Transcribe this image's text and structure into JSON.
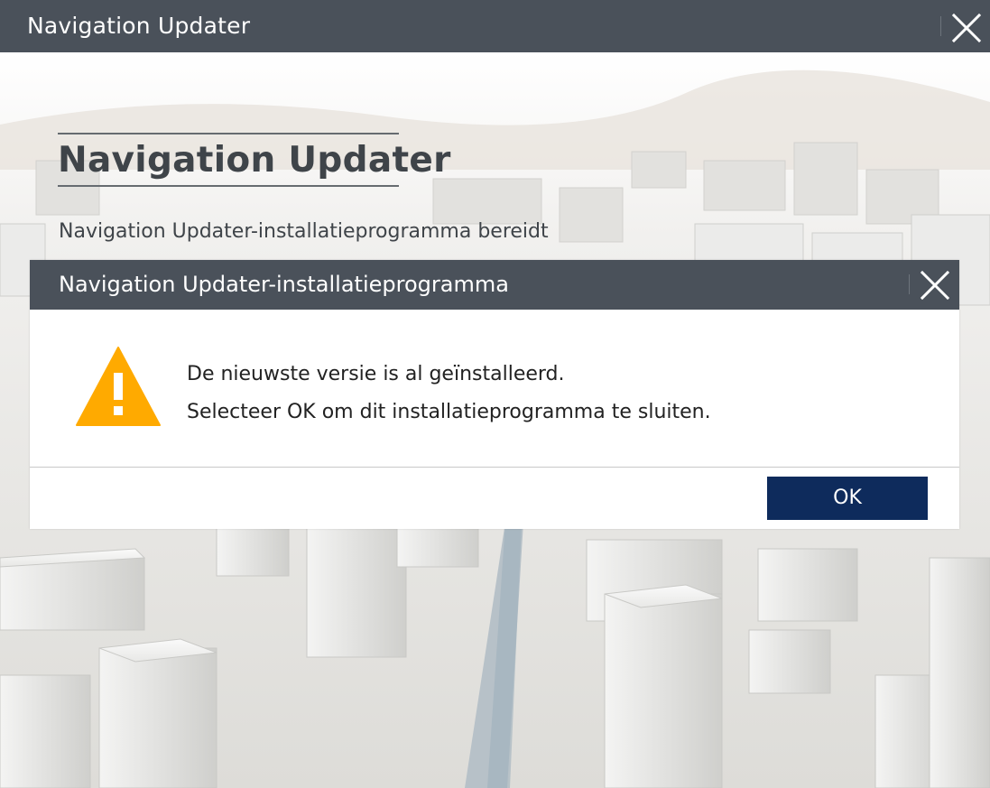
{
  "window": {
    "title": "Navigation Updater",
    "close_icon": "close-icon"
  },
  "hero": {
    "heading": "Navigation Updater",
    "description": "Navigation Updater-installatieprogramma bereidt"
  },
  "dialog": {
    "title": "Navigation Updater-installatieprogramma",
    "close_icon": "close-icon",
    "warning_icon": "warning-triangle-icon",
    "message_line1": "De nieuwste versie is al geïnstalleerd.",
    "message_line2": "Selecteer OK om dit installatieprogramma te sluiten.",
    "ok_label": "OK"
  },
  "colors": {
    "titlebar": "#4a515a",
    "ok_button": "#0e2b5c",
    "warning": "#ffaa00",
    "heading_text": "#3f4449"
  }
}
